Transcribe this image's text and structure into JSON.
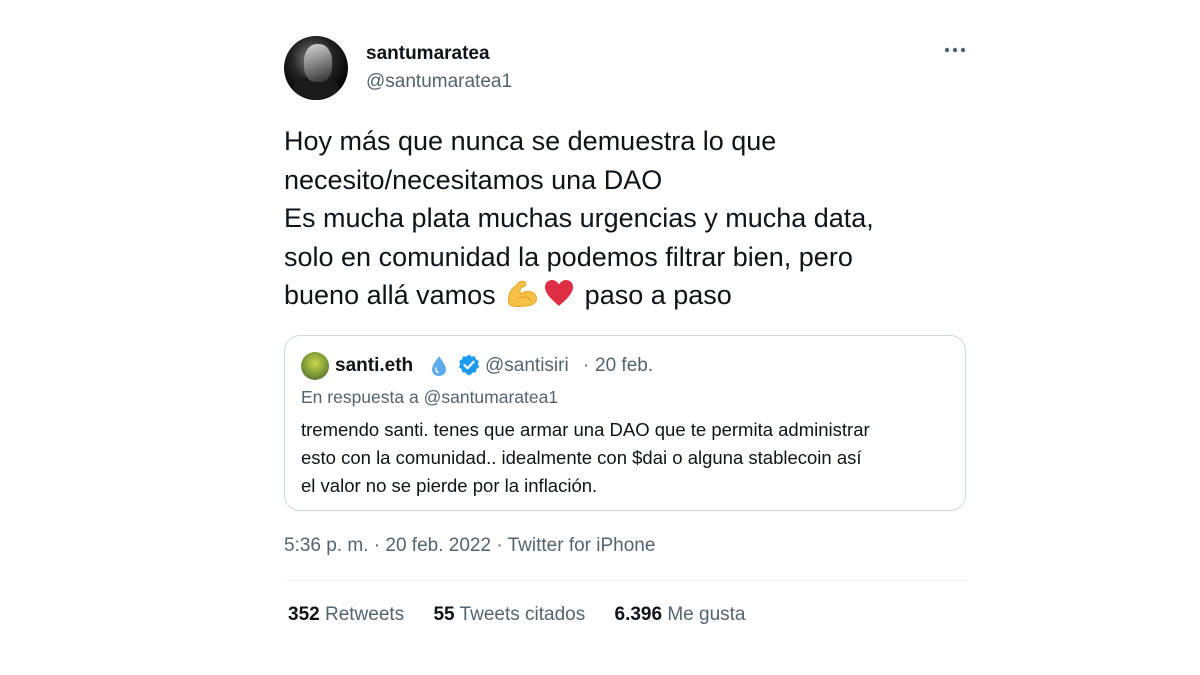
{
  "author": {
    "display_name": "santumaratea",
    "handle": "@santumaratea1"
  },
  "more_icon": "more-horizontal-icon",
  "tweet_text": [
    "Hoy más que nunca se demuestra lo que",
    "necesito/necesitamos una DAO",
    "Es mucha plata muchas urgencias y mucha data,",
    "solo en comunidad la podemos filtrar bien, pero",
    "bueno allá vamos",
    "paso a paso"
  ],
  "emojis": [
    "flexed-biceps-emoji",
    "red-heart-emoji"
  ],
  "quoted": {
    "display_name": "santi.eth",
    "handle": "@santisiri",
    "separator": "·",
    "date": "20 feb.",
    "reply_prefix": "En respuesta a",
    "reply_to": "@santumaratea1",
    "text": [
      "tremendo santi. tenes que armar una DAO que te permita administrar",
      "esto con la comunidad.. idealmente con $dai o alguna stablecoin así",
      "el valor no se pierde por la inflación."
    ],
    "badges": [
      "droplet-emoji",
      "verified-badge-icon"
    ]
  },
  "meta": {
    "time": "5:36 p. m.",
    "sep1": " · ",
    "date": "20 feb. 2022",
    "sep2": " · ",
    "source": "Twitter for iPhone"
  },
  "stats": {
    "retweets_count": "352",
    "retweets_label": "Retweets",
    "quotes_count": "55",
    "quotes_label": "Tweets citados",
    "likes_count": "6.396",
    "likes_label": "Me gusta"
  },
  "colors": {
    "text": "#0f1419",
    "secondary": "#536471",
    "border": "#cfd9de",
    "verified": "#1d9bf0",
    "heart": "#dd2e44"
  }
}
